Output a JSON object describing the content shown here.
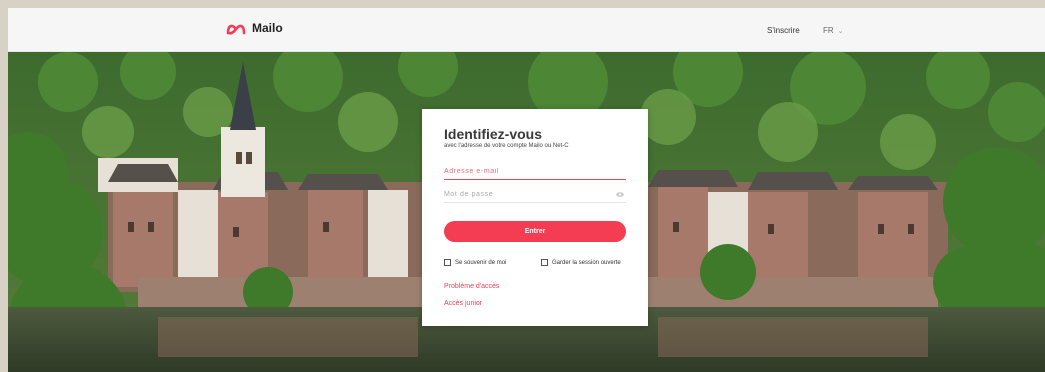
{
  "header": {
    "brand": "Mailo",
    "signup_label": "S'inscrire",
    "language": "FR"
  },
  "login": {
    "title": "Identifiez-vous",
    "subtitle": "avec l'adresse de votre compte Mailo ou Net-C",
    "email_placeholder": "Adresse e-mail",
    "password_placeholder": "Mot de passe",
    "submit_label": "Entrer",
    "remember_label": "Se souvenir de moi",
    "keep_session_label": "Garder la session ouverte",
    "access_problem_link": "Problème d'accès",
    "junior_access_link": "Accès junior"
  },
  "colors": {
    "accent": "#f43c53",
    "header_bg": "#f6f6f6"
  }
}
